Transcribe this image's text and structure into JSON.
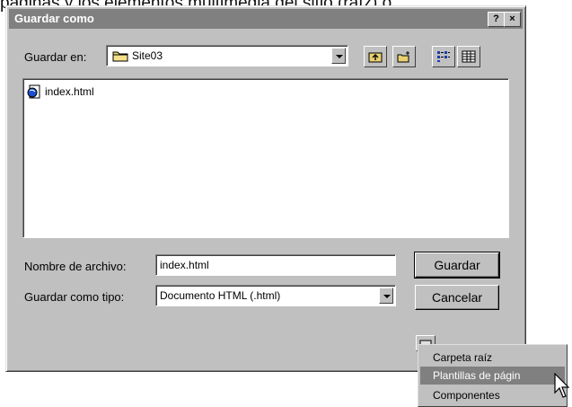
{
  "background_text": "páginas y los elementos multimedia del sitio (raíz) o",
  "dialog": {
    "title": "Guardar como",
    "help_button": "?",
    "close_button": "×"
  },
  "save_in": {
    "label": "Guardar en:",
    "value": "Site03"
  },
  "files": [
    {
      "name": "index.html",
      "icon": "html-document-icon"
    }
  ],
  "filename": {
    "label": "Nombre de archivo:",
    "value": "index.html"
  },
  "filetype": {
    "label": "Guardar como tipo:",
    "value": "Documento HTML (.html)"
  },
  "buttons": {
    "save": "Guardar",
    "cancel": "Cancelar"
  },
  "popup_menu": [
    {
      "label": "Carpeta raíz",
      "selected": false
    },
    {
      "label": "Plantillas de págin",
      "selected": true
    },
    {
      "label": "Componentes",
      "selected": false
    }
  ],
  "colors": {
    "titlebar": "#808080",
    "face": "#c0c0c0",
    "selection": "#808080"
  }
}
